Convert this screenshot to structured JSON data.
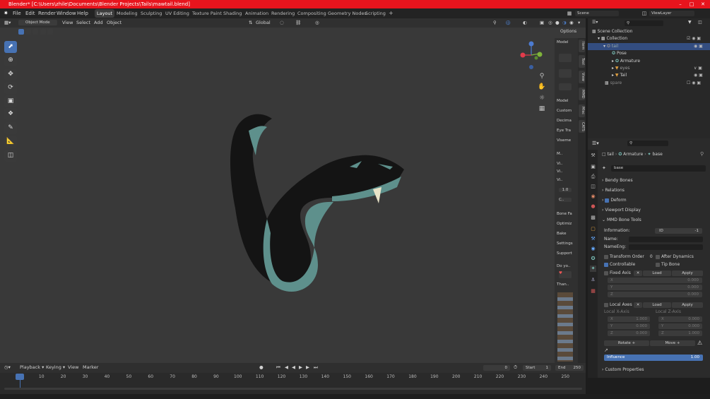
{
  "window": {
    "title": "Blender* [C:\\Users\\zhile\\Documents\\Blender Projects\\Tails\\mawtail.blend]"
  },
  "topbar": {
    "menus": [
      "File",
      "Edit",
      "Render",
      "Window",
      "Help"
    ],
    "workspaces": [
      "Layout",
      "Modeling",
      "Sculpting",
      "UV Editing",
      "Texture Paint",
      "Shading",
      "Animation",
      "Rendering",
      "Compositing",
      "Geometry Nodes",
      "Scripting"
    ],
    "active_workspace": "Layout",
    "scene": "Scene",
    "view_layer": "ViewLayer"
  },
  "viewport_header": {
    "mode": "Object Mode",
    "menus": [
      "View",
      "Select",
      "Add",
      "Object"
    ],
    "orientation": "Global",
    "options_label": "Options"
  },
  "n_panel": {
    "items": [
      "Model",
      "Model",
      "Custom",
      "Decima",
      "Eye Tra",
      "Viseme",
      "M..",
      "Vi..",
      "Vi..",
      "Vi..",
      "1.0",
      "C..",
      "Bone Fa",
      "Optimiz",
      "Bake",
      "Settings",
      "Support",
      "Do yo..",
      "Than.."
    ]
  },
  "vertical_tabs": [
    "Item",
    "Tool",
    "View",
    "MMD",
    "Misc",
    "CATS"
  ],
  "outliner": {
    "rows": [
      {
        "label": "Scene Collection",
        "indent": 0,
        "active": false
      },
      {
        "label": "Collection",
        "indent": 1,
        "active": false
      },
      {
        "label": "tail",
        "indent": 2,
        "active": true
      },
      {
        "label": "Pose",
        "indent": 3,
        "active": false
      },
      {
        "label": "Armature",
        "indent": 3,
        "active": false
      },
      {
        "label": "eyes",
        "indent": 2,
        "active": false
      },
      {
        "label": "Tail",
        "indent": 2,
        "active": false
      },
      {
        "label": "spare",
        "indent": 1,
        "active": false
      }
    ]
  },
  "properties": {
    "breadcrumb": [
      "tail",
      "Armature",
      "base"
    ],
    "bone_name": "base",
    "sections": [
      "Bendy Bones",
      "Relations",
      "Deform",
      "Viewport Display",
      "MMD Bone Tools"
    ],
    "mmd": {
      "information_label": "Information:",
      "id_label": "ID",
      "id_value": "-1",
      "name_label": "Name:",
      "name_eng_label": "NameEng:",
      "transform_order_label": "Transform Order",
      "transform_order_value": "0",
      "after_dynamics": "After Dynamics",
      "controllable": "Controllable",
      "tip_bone": "Tip Bone",
      "fixed_axis": "Fixed Axis",
      "local_axes": "Local Axes",
      "load": "Load",
      "apply": "Apply",
      "local_x_axis": "Local X-Axis",
      "local_z_axis": "Local Z-Axis",
      "axis_values": [
        "0.000",
        "0.000",
        "0.000"
      ],
      "local_x_values": [
        "1.000",
        "0.000",
        "0.000"
      ],
      "local_z_values": [
        "0.000",
        "0.000",
        "1.000"
      ],
      "rotate": "Rotate +",
      "move": "Move +",
      "influence_label": "Influence",
      "influence_value": "1.00"
    },
    "custom_properties": "Custom Properties"
  },
  "timeline": {
    "menus": [
      "Playback",
      "Keying",
      "View",
      "Marker"
    ],
    "current_frame": "0",
    "start_label": "Start",
    "start": "1",
    "end_label": "End",
    "end": "250",
    "ticks": [
      "0",
      "10",
      "20",
      "30",
      "40",
      "50",
      "60",
      "70",
      "80",
      "90",
      "100",
      "110",
      "120",
      "130",
      "140",
      "150",
      "160",
      "170",
      "180",
      "190",
      "200",
      "210",
      "220",
      "230",
      "240",
      "250"
    ]
  },
  "colors": {
    "title_bar": "#e8141d",
    "accent": "#4772b3",
    "snake_dark": "#111111",
    "snake_teal": "#5e908c"
  }
}
